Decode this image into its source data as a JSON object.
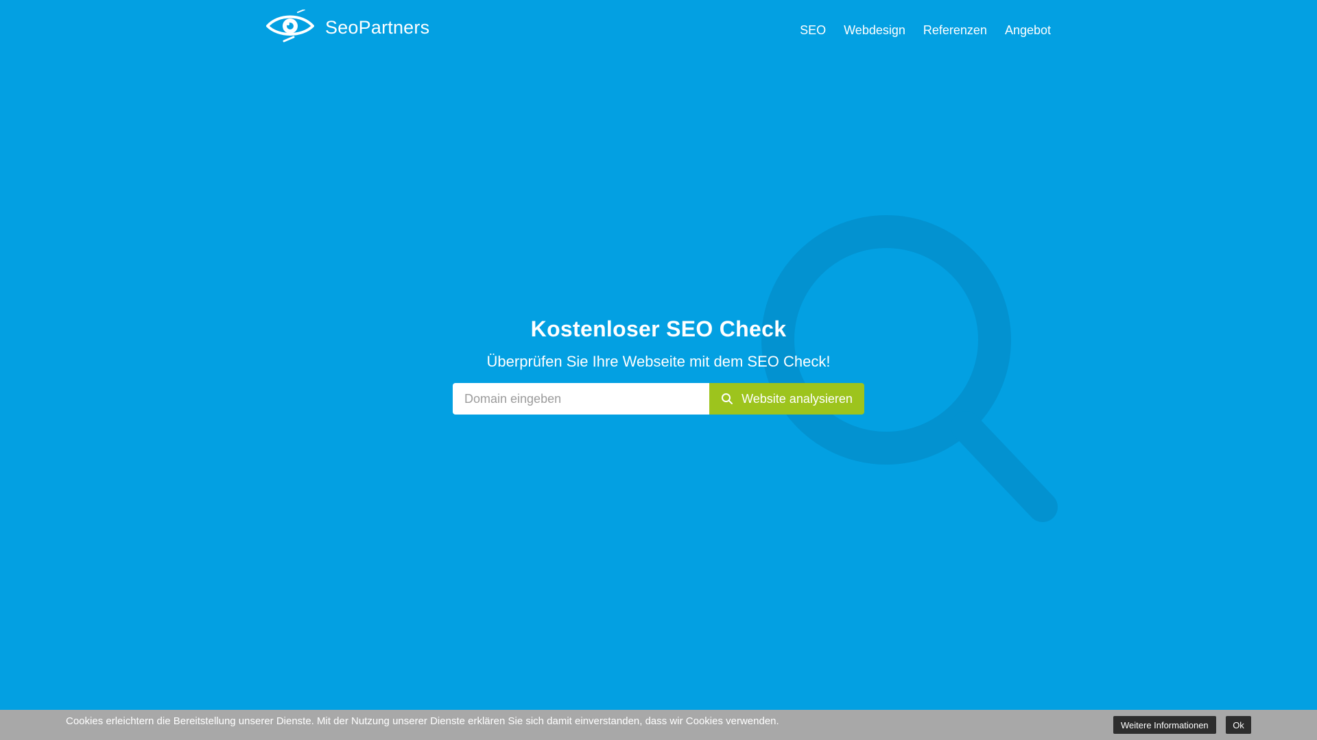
{
  "header": {
    "brand_name": "SeoPartners",
    "logo_icon": "eye-icon",
    "nav": [
      {
        "label": "SEO"
      },
      {
        "label": "Webdesign"
      },
      {
        "label": "Referenzen"
      },
      {
        "label": "Angebot"
      }
    ]
  },
  "hero": {
    "title": "Kostenloser SEO Check",
    "subtitle": "Überprüfen Sie Ihre Webseite mit dem SEO Check!",
    "search": {
      "placeholder": "Domain eingeben",
      "value": "",
      "button_label": "Website analysieren",
      "button_icon": "search-icon"
    },
    "background_icon": "magnifier-icon"
  },
  "cookie_bar": {
    "text": "Cookies erleichtern die Bereitstellung unserer Dienste. Mit der Nutzung unserer Dienste erklären Sie sich damit einverstanden, dass wir Cookies verwenden.",
    "more_label": "Weitere Informationen",
    "ok_label": "Ok"
  },
  "colors": {
    "background": "#03a0e2",
    "accent_button": "#9dc41d",
    "cookie_bar": "#a8a8a8",
    "cookie_button": "#2d2d2d",
    "magnifier": "#0392d0"
  }
}
